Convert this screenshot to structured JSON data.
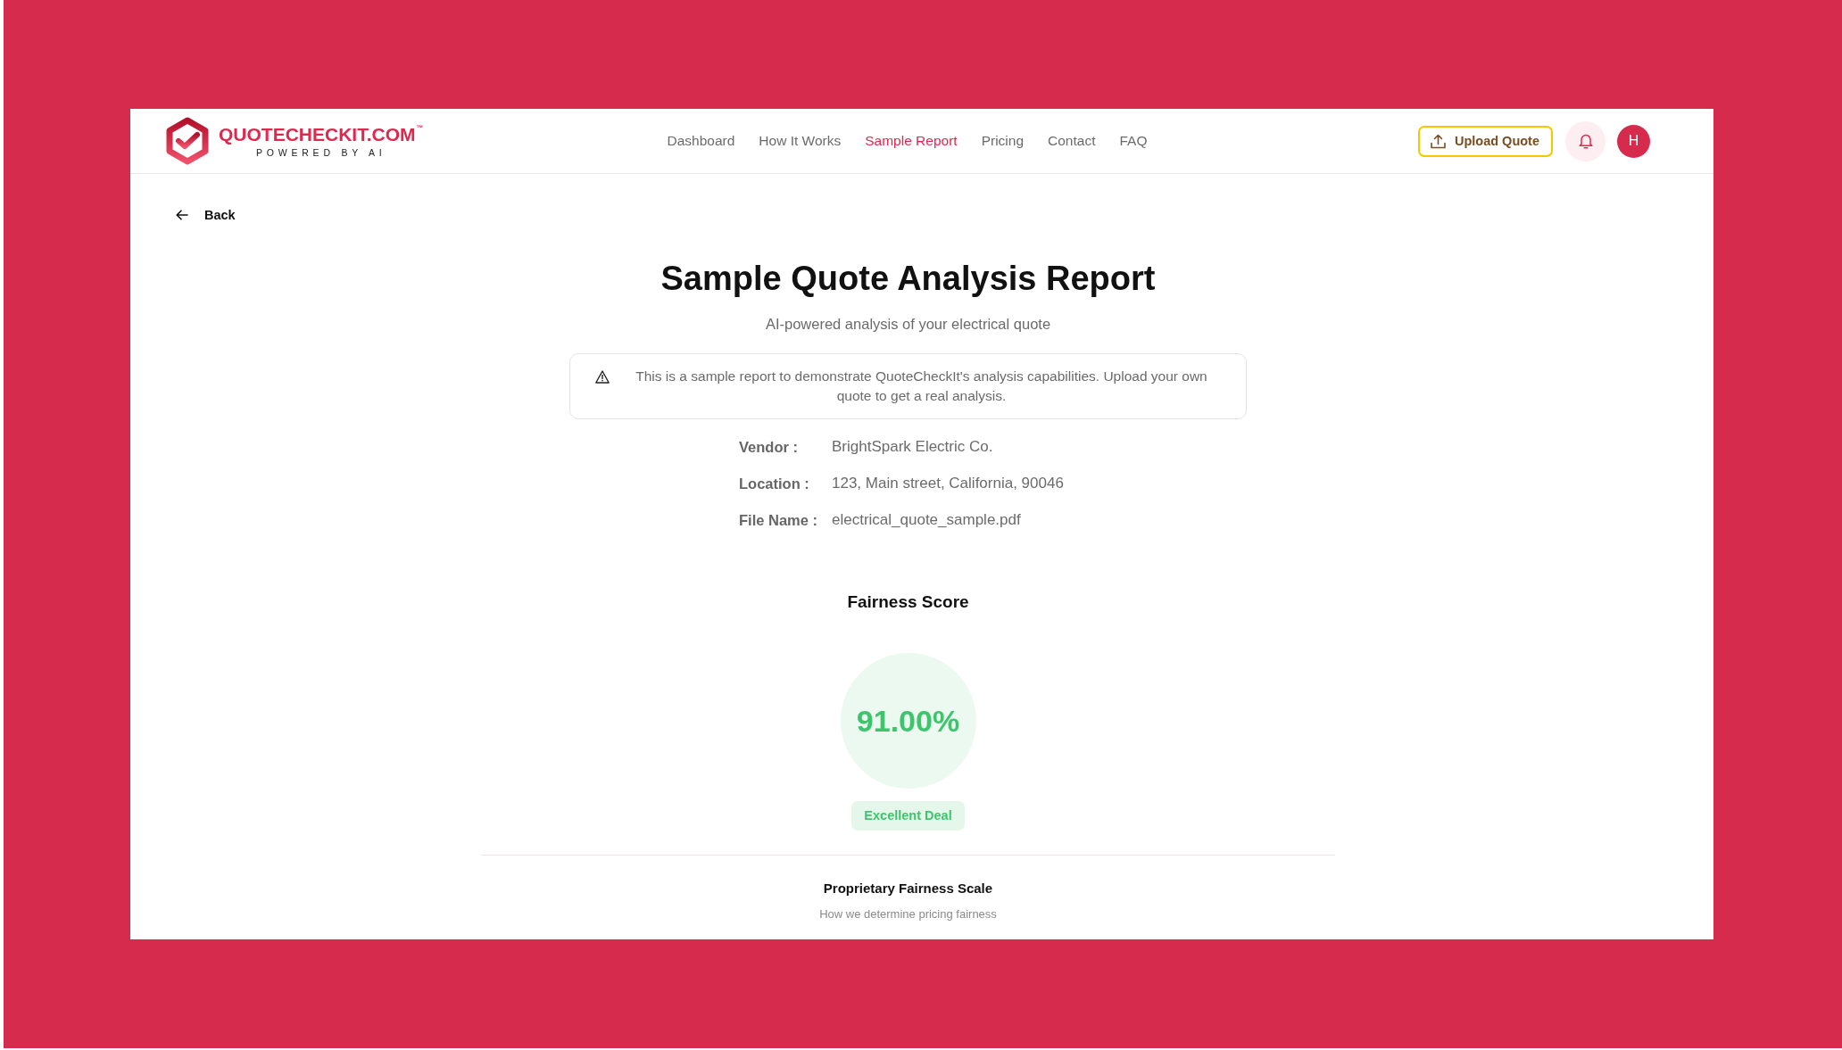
{
  "header": {
    "logo": {
      "wordmark": "QUOTECHECKIT.COM",
      "trademark": "™",
      "tagline": "POWERED BY AI"
    },
    "nav": [
      {
        "label": "Dashboard",
        "selected": false
      },
      {
        "label": "How It Works",
        "selected": false
      },
      {
        "label": "Sample Report",
        "selected": true
      },
      {
        "label": "Pricing",
        "selected": false
      },
      {
        "label": "Contact",
        "selected": false
      },
      {
        "label": "FAQ",
        "selected": false
      }
    ],
    "upload_button": {
      "label": "Upload Quote"
    },
    "avatar": {
      "initial": "H"
    }
  },
  "back_link": {
    "label": "Back"
  },
  "report": {
    "title": "Sample Quote Analysis Report",
    "subtitle": "AI-powered analysis of your electrical quote",
    "notice": "This is a sample report to demonstrate QuoteCheckIt's analysis capabilities. Upload your own quote to get a real analysis.",
    "details": [
      {
        "label": "Vendor :",
        "value": "BrightSpark Electric Co."
      },
      {
        "label": "Location :",
        "value": "123, Main street, California, 90046"
      },
      {
        "label": "File Name :",
        "value": "electrical_quote_sample.pdf"
      }
    ],
    "fairness_score": {
      "heading": "Fairness Score",
      "value": "91.00%",
      "rating": "Excellent Deal"
    },
    "scale": {
      "title": "Proprietary Fairness Scale",
      "subtitle": "How we determine pricing fairness"
    }
  }
}
